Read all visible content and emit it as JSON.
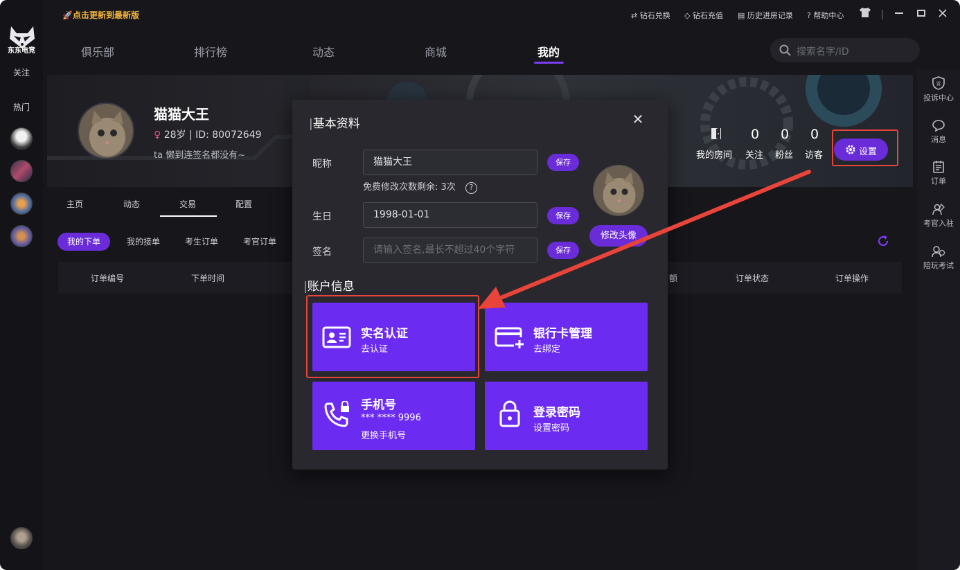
{
  "app": {
    "logo_text": "东东电竞",
    "update_link": "点击更新到最新版"
  },
  "left_sidebar": {
    "follow_label": "关注",
    "hot_label": "热门"
  },
  "top_tools": {
    "diamond_exchange": "钻石兑换",
    "diamond_recharge": "钻石充值",
    "room_history": "历史进房记录",
    "help_center": "帮助中心"
  },
  "nav": {
    "tabs": [
      {
        "label": "俱乐部"
      },
      {
        "label": "排行榜"
      },
      {
        "label": "动态"
      },
      {
        "label": "商城"
      },
      {
        "label": "我的"
      }
    ],
    "active_tab": "我的"
  },
  "search": {
    "placeholder": "搜索名字/ID"
  },
  "right_sidebar": {
    "items": [
      {
        "label": "投诉中心",
        "icon": "shield-icon"
      },
      {
        "label": "消息",
        "icon": "message-icon"
      },
      {
        "label": "订单",
        "icon": "order-icon"
      },
      {
        "label": "考官入驻",
        "icon": "examiner-icon"
      },
      {
        "label": "陪玩考试",
        "icon": "exam-icon"
      }
    ]
  },
  "profile": {
    "name": "猫猫大王",
    "age": "28岁",
    "id_text": "ID: 80072649",
    "signature": "ta 懒到连签名都没有~",
    "my_room": "我的房间",
    "stats": [
      {
        "label": "关注",
        "value": "0"
      },
      {
        "label": "粉丝",
        "value": "0"
      },
      {
        "label": "访客",
        "value": "0"
      }
    ],
    "settings_label": "设置"
  },
  "sub_tabs": [
    "主页",
    "动态",
    "交易",
    "配置"
  ],
  "order_filters": [
    "我的下单",
    "我的接单",
    "考生订单",
    "考官订单"
  ],
  "table": {
    "headers": [
      "订单编号",
      "下单时间",
      "额",
      "订单状态",
      "订单操作"
    ]
  },
  "modal": {
    "title": "基本资料",
    "nickname_label": "昵称",
    "nickname_value": "猫猫大王",
    "free_changes_hint": "免费修改次数剩余: 3次",
    "birthday_label": "生日",
    "birthday_value": "1998-01-01",
    "signature_label": "签名",
    "signature_placeholder": "请输入签名,最长不超过40个字符",
    "save_label": "保存",
    "change_avatar_label": "修改头像",
    "account_section_title": "账户信息",
    "cards": [
      {
        "title": "实名认证",
        "subtitle": "去认证",
        "icon": "id-card-icon"
      },
      {
        "title": "银行卡管理",
        "subtitle": "去绑定",
        "icon": "bank-card-icon"
      },
      {
        "title": "手机号",
        "subtitle": "*** **** 9996",
        "subtitle2": "更换手机号",
        "icon": "phone-icon"
      },
      {
        "title": "登录密码",
        "subtitle": "设置密码",
        "icon": "lock-icon"
      }
    ]
  },
  "colors": {
    "accent": "#6c2bf0",
    "highlight": "#e8443a",
    "update": "#f0b43c"
  }
}
